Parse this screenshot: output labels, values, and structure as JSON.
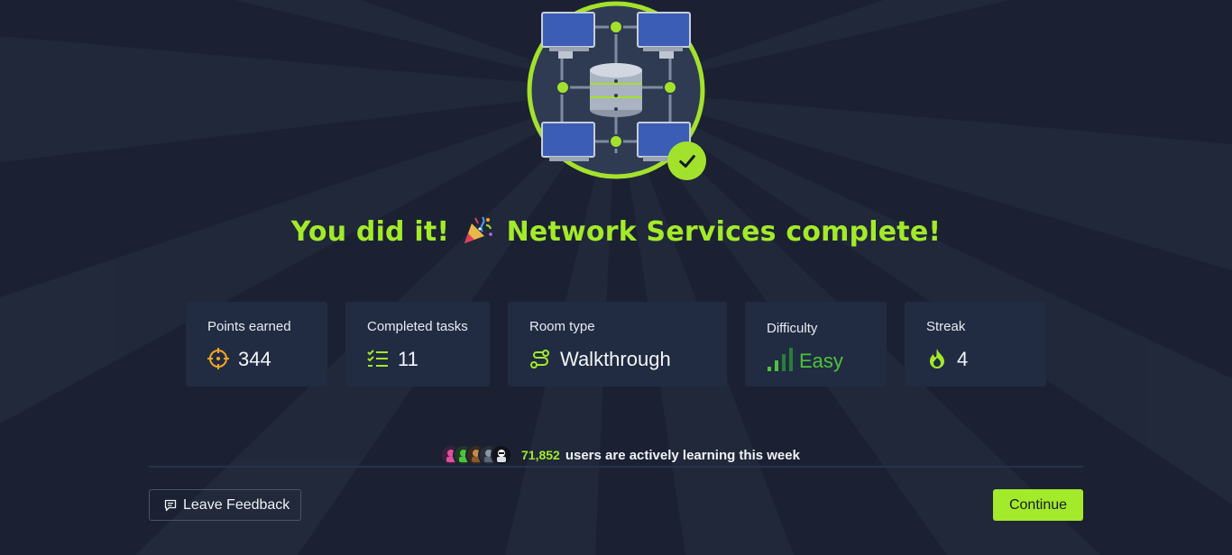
{
  "headline": {
    "before": "You did it!",
    "after": "Network Services complete!"
  },
  "stats": {
    "points": {
      "label": "Points earned",
      "value": "344",
      "icon": "crosshair-icon"
    },
    "tasks": {
      "label": "Completed tasks",
      "value": "11",
      "icon": "checklist-icon"
    },
    "room_type": {
      "label": "Room type",
      "value": "Walkthrough",
      "icon": "route-icon"
    },
    "difficulty": {
      "label": "Difficulty",
      "value": "Easy",
      "icon": "signal-bars-icon",
      "bars_filled": 2,
      "bars_total": 4
    },
    "streak": {
      "label": "Streak",
      "value": "4",
      "icon": "flame-icon"
    }
  },
  "learners": {
    "count": "71,852",
    "text": "users are actively learning this week"
  },
  "footer": {
    "feedback_label": "Leave Feedback",
    "continue_label": "Continue"
  },
  "colors": {
    "background": "#1b2132",
    "card": "#212c42",
    "accent": "#a3ea2a",
    "orange": "#f5a623",
    "easy_green": "#4cc43a"
  }
}
